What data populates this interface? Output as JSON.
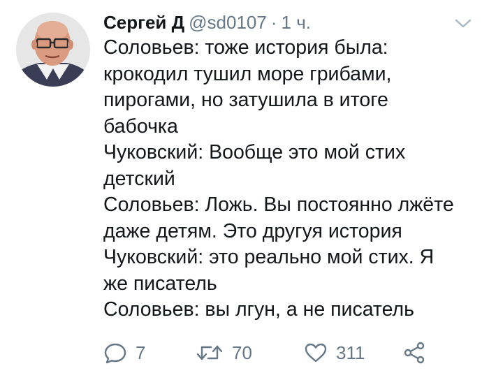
{
  "tweet": {
    "author": {
      "name": "Сергей Д",
      "handle": "@sd0107",
      "separator": "·",
      "time": "1 ч."
    },
    "text_lines": [
      "Соловьев: тоже история была:",
      "крокодил тушил море грибами,",
      "пирогами, но затушила в итоге",
      "бабочка",
      "Чуковский: Вообще это мой стих",
      "детский",
      "Соловьев: Ложь. Вы постоянно лжёте",
      "даже детям. Это другуя история",
      "Чуковский: это реально мой стих. Я",
      "же писатель",
      "Соловьев: вы лгун, а не писатель"
    ],
    "actions": {
      "reply_count": "7",
      "retweet_count": "70",
      "like_count": "311"
    }
  },
  "icons": {
    "reply": "reply-icon",
    "retweet": "retweet-icon",
    "like": "heart-icon",
    "share": "share-icon",
    "menu": "chevron-down-icon"
  },
  "colors": {
    "text": "#14171a",
    "secondary": "#657786",
    "background": "#ffffff"
  }
}
